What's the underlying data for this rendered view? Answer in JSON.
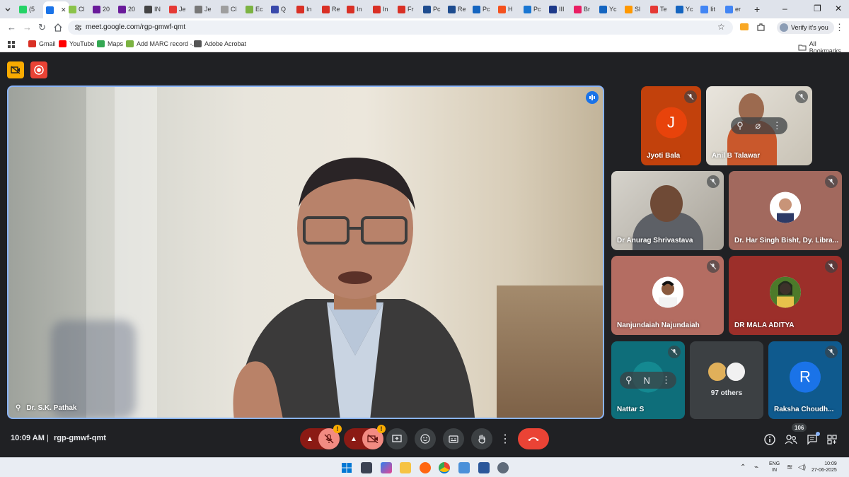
{
  "browser": {
    "tabs": [
      {
        "label": "(5",
        "color": "#25d366"
      },
      {
        "label": "",
        "color": "#1a73e8",
        "active": true,
        "icon": "speaker-icon"
      },
      {
        "label": "Cl",
        "color": "#8bc34a"
      },
      {
        "label": "20",
        "color": "#6a1b9a"
      },
      {
        "label": "20",
        "color": "#6a1b9a"
      },
      {
        "label": "IN",
        "color": "#444444"
      },
      {
        "label": "Je",
        "color": "#e53935"
      },
      {
        "label": "Je",
        "color": "#777777"
      },
      {
        "label": "Cl",
        "color": "#9e9e9e"
      },
      {
        "label": "Ec",
        "color": "#7cb342"
      },
      {
        "label": "Q",
        "color": "#3949ab"
      },
      {
        "label": "In",
        "color": "#d93025"
      },
      {
        "label": "Re",
        "color": "#d93025"
      },
      {
        "label": "In",
        "color": "#d93025"
      },
      {
        "label": "In",
        "color": "#d93025"
      },
      {
        "label": "Fr",
        "color": "#d93025"
      },
      {
        "label": "Pc",
        "color": "#1e4c8f"
      },
      {
        "label": "Re",
        "color": "#1e4c8f"
      },
      {
        "label": "Pc",
        "color": "#1565c0"
      },
      {
        "label": "H",
        "color": "#f4511e"
      },
      {
        "label": "Pc",
        "color": "#1976d2"
      },
      {
        "label": "III",
        "color": "#1e3a8a"
      },
      {
        "label": "Br",
        "color": "#e91e63"
      },
      {
        "label": "Yc",
        "color": "#1565c0"
      },
      {
        "label": "Sl",
        "color": "#ff9800"
      },
      {
        "label": "Te",
        "color": "#e53935"
      },
      {
        "label": "Yc",
        "color": "#1565c0"
      },
      {
        "label": "Iit",
        "color": "#4285f4"
      },
      {
        "label": "er",
        "color": "#4285f4"
      }
    ],
    "new_tab": "+",
    "url": "meet.google.com/rgp-gmwf-qmt",
    "verify_label": "Verify it's you",
    "bookmarks": [
      {
        "label": "Gmail",
        "color": "#d93025"
      },
      {
        "label": "YouTube",
        "color": "#ff0000"
      },
      {
        "label": "Maps",
        "color": "#34a853"
      },
      {
        "label": "Add MARC record -...",
        "color": "#7cb342"
      },
      {
        "label": "Adobe Acrobat",
        "color": "#555555"
      }
    ],
    "all_bookmarks": "All Bookmarks"
  },
  "meet": {
    "main_speaker": "Dr. S.K. Pathak",
    "participants": [
      {
        "name": "Jyoti Bala",
        "avatar_letter": "J",
        "avatar_color": "#e8430b",
        "bg": "#c2410c"
      },
      {
        "name": "Anil B Talawar"
      },
      {
        "name": "Dr Anurag Shrivastava"
      },
      {
        "name": "Dr. Har Singh Bisht, Dy. Libra..."
      },
      {
        "name": "Nanjundaiah Najundaiah"
      },
      {
        "name": "DR MALA ADITYA"
      },
      {
        "name": "Nattar S",
        "avatar_letter": "N"
      },
      {
        "name": "Raksha Choudh...",
        "avatar_letter": "R",
        "avatar_color": "#1a73e8"
      }
    ],
    "others_label": "97 others",
    "clock": "10:09 AM",
    "separator": "|",
    "meeting_code": "rgp-gmwf-qmt",
    "participant_count": "106"
  },
  "taskbar": {
    "lang_top": "ENG",
    "lang_bottom": "IN",
    "time": "10:09",
    "date": "27-06-2025"
  }
}
